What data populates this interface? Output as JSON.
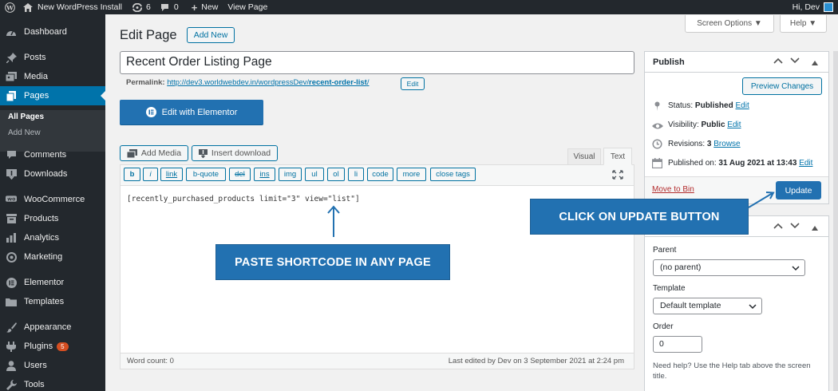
{
  "admin_bar": {
    "site_name": "New WordPress Install",
    "updates_count": "6",
    "comments_count": "0",
    "new_label": "New",
    "view_page_label": "View Page",
    "greeting": "Hi, Dev"
  },
  "sidebar": {
    "dashboard": "Dashboard",
    "posts": "Posts",
    "media": "Media",
    "pages": "Pages",
    "all_pages": "All Pages",
    "add_new": "Add New",
    "comments": "Comments",
    "downloads": "Downloads",
    "woocommerce": "WooCommerce",
    "products": "Products",
    "analytics": "Analytics",
    "marketing": "Marketing",
    "elementor": "Elementor",
    "templates": "Templates",
    "appearance": "Appearance",
    "plugins": "Plugins",
    "plugins_badge": "5",
    "users": "Users",
    "tools": "Tools"
  },
  "header": {
    "title": "Edit Page",
    "add_new_label": "Add New",
    "screen_options_label": "Screen Options ▼",
    "help_label": "Help ▼"
  },
  "post": {
    "title": "Recent Order Listing Page",
    "permalink_label": "Permalink:",
    "permalink_base": "http://dev3.worldwebdev.in/wordpressDev/",
    "permalink_slug": "recent-order-list",
    "permalink_trail": "/",
    "permalink_edit_label": "Edit",
    "elementor_label": "Edit with Elementor"
  },
  "editor": {
    "add_media_label": "Add Media",
    "insert_download_label": "Insert download",
    "tab_visual": "Visual",
    "tab_text": "Text",
    "quicktags": [
      "b",
      "i",
      "link",
      "b-quote",
      "del",
      "ins",
      "img",
      "ul",
      "ol",
      "li",
      "code",
      "more",
      "close tags"
    ],
    "content": "[recently_purchased_products limit=\"3\" view=\"list\"]",
    "word_count": "Word count: 0",
    "last_edited": "Last edited by Dev on 3 September 2021 at 2:24 pm"
  },
  "publish": {
    "title": "Publish",
    "preview_label": "Preview Changes",
    "status_label": "Status:",
    "status_value": "Published",
    "visibility_label": "Visibility:",
    "visibility_value": "Public",
    "revisions_label": "Revisions:",
    "revisions_value": "3",
    "browse_label": "Browse",
    "published_on_label": "Published on:",
    "published_on_value": "31 Aug 2021 at 13:43",
    "edit_label": "Edit",
    "move_to_bin_label": "Move to Bin",
    "update_label": "Update"
  },
  "page_attributes": {
    "parent_label": "Parent",
    "parent_value": "(no parent)",
    "template_label": "Template",
    "template_value": "Default template",
    "order_label": "Order",
    "order_value": "0",
    "help_text": "Need help? Use the Help tab above the screen title."
  },
  "callouts": {
    "update": "CLICK ON UPDATE BUTTON",
    "paste": "PASTE SHORTCODE IN ANY PAGE"
  },
  "colors": {
    "admin_dark": "#23282d",
    "wp_blue": "#0073aa",
    "callout_blue": "#2271b1",
    "delete_red": "#a00"
  }
}
